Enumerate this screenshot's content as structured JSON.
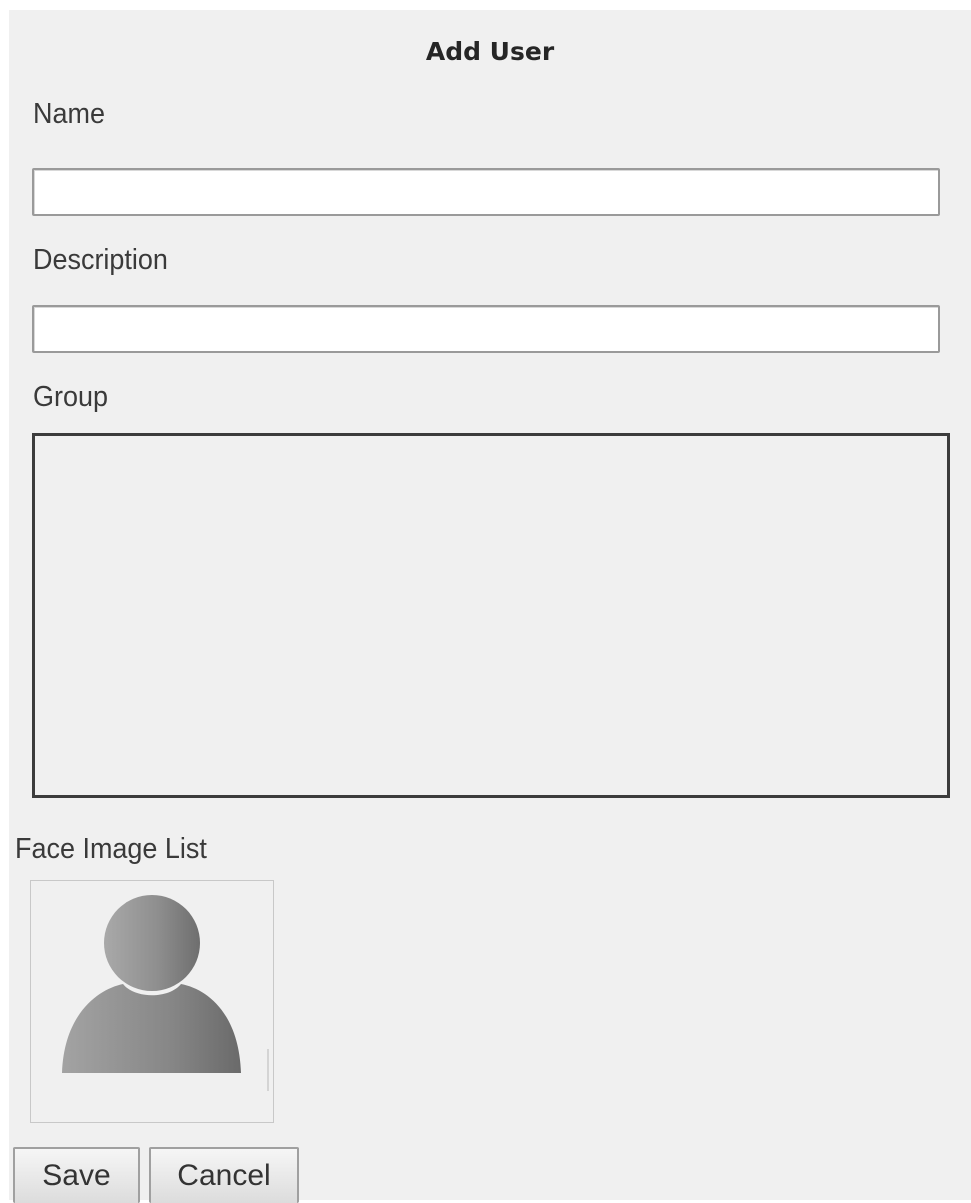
{
  "dialog": {
    "title": "Add User"
  },
  "form": {
    "name_label": "Name",
    "name_value": "",
    "description_label": "Description",
    "description_value": "",
    "group_label": "Group",
    "face_list_label": "Face Image List",
    "face_placeholder_icon": "user-silhouette-icon"
  },
  "buttons": {
    "save_label": "Save",
    "cancel_label": "Cancel"
  },
  "colors": {
    "dialog_background": "#f0f0f0",
    "input_background": "#ffffff",
    "silhouette": "#8a8a8a"
  }
}
